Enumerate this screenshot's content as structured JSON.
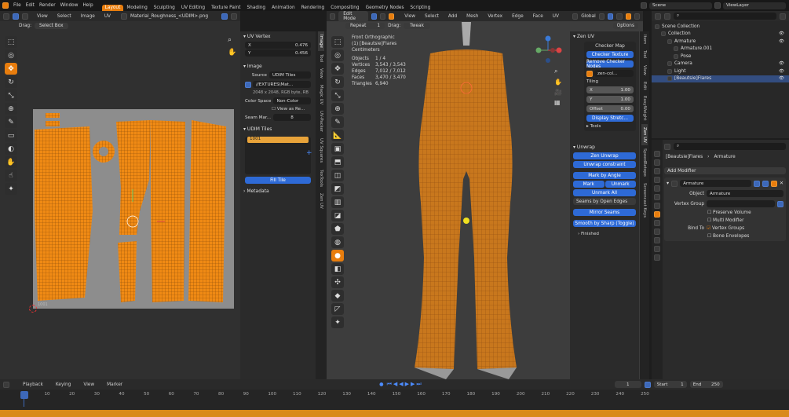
{
  "topbar": {
    "menus": [
      "File",
      "Edit",
      "Render",
      "Window",
      "Help"
    ],
    "workspaces": [
      "Layout",
      "Modeling",
      "Sculpting",
      "UV Editing",
      "Texture Paint",
      "Shading",
      "Animation",
      "Rendering",
      "Compositing",
      "Geometry Nodes",
      "Scripting"
    ],
    "active_workspace": "Layout",
    "scene": "Scene",
    "view_layer": "ViewLayer"
  },
  "uv_editor": {
    "menus": [
      "View",
      "Select",
      "Image",
      "UV"
    ],
    "image_name": "Material_Roughness_<UDIM>.png",
    "drag_label": "Drag:",
    "drag_value": "Select Box",
    "origin_label": "1001"
  },
  "uv_sidebar": {
    "tabs": [
      "Image",
      "Tool",
      "View",
      "Magic UV",
      "UV-Packer",
      "UV Squares",
      "TexTools",
      "Zen UV"
    ],
    "uv_vertex": {
      "title": "UV Vertex",
      "x_label": "X",
      "x_value": "0.476",
      "y_label": "Y",
      "y_value": "0.456"
    },
    "image": {
      "title": "Image",
      "source_label": "Source",
      "source_value": "UDIM Tiles",
      "path": "//EXTURES\\Mat...",
      "info": "2048 x 2048, RGB byte, RB",
      "colorspace_label": "Color Space",
      "colorspace_value": "Non-Color",
      "view_as_render": "View as Re...",
      "seam_label": "Seam Mar...",
      "seam_value": "8"
    },
    "udim": {
      "title": "UDIM Tiles",
      "tile": "1001",
      "fill_tile": "Fill Tile"
    },
    "metadata": "Metadata"
  },
  "viewport": {
    "mode": "Edit Mode",
    "menus": [
      "View",
      "Select",
      "Add",
      "Mesh",
      "Vertex",
      "Edge",
      "Face",
      "UV"
    ],
    "transform": "Global",
    "options": "Options",
    "repeat": "Repeat",
    "repeat_value": "1",
    "drag_label": "Drag:",
    "drag_value": "Tweak",
    "stats": {
      "view": "Front Orthographic",
      "object": "(1) [Beautsie]Flares",
      "units": "Centimeters",
      "rows": [
        [
          "Objects",
          "1 / 4"
        ],
        [
          "Vertices",
          "3,543 / 3,543"
        ],
        [
          "Edges",
          "7,012 / 7,012"
        ],
        [
          "Faces",
          "3,470 / 3,470"
        ],
        [
          "Triangles",
          "6,940"
        ]
      ]
    }
  },
  "zen_uv": {
    "title": "Zen UV",
    "tabs": [
      "Item",
      "Tool",
      "View",
      "Edit",
      "EasyWeight",
      "Zen UV",
      "SpeedRetopo",
      "Screencast Keys"
    ],
    "checker_map": "Checker Map",
    "checker_texture": "Checker Texture",
    "remove_checker": "Remove Checker Nodes",
    "checker_image": "zen-col...",
    "tiling": "Tiling",
    "tx_label": "X",
    "tx": "1.00",
    "ty_label": "Y",
    "ty": "1.00",
    "offset_label": "Offset",
    "offset": "0.00",
    "display_stretch": "Display Stretc...",
    "tools": "Tools",
    "unwrap_title": "Unwrap",
    "zen_unwrap": "Zen Unwrap",
    "unwrap_constraint": "Unwrap constraint",
    "mark_by_angle": "Mark by Angle",
    "mark": "Mark",
    "unmark": "Unmark",
    "unmark_all": "Unmark All",
    "seams_open_edges": "Seams by Open Edges",
    "mirror_seams": "Mirror Seams",
    "smooth_sharp": "Smooth by Sharp (Toggle)",
    "finished": "Finished"
  },
  "outliner": {
    "items": [
      {
        "label": "Scene Collection",
        "indent": 0
      },
      {
        "label": "Collection",
        "indent": 1
      },
      {
        "label": "Armature",
        "indent": 2
      },
      {
        "label": "Armature.001",
        "indent": 3
      },
      {
        "label": "Pose",
        "indent": 3
      },
      {
        "label": "Camera",
        "indent": 2
      },
      {
        "label": "Light",
        "indent": 2
      },
      {
        "label": "[Beautsie]Flares",
        "indent": 2,
        "selected": true
      }
    ]
  },
  "properties": {
    "breadcrumb_obj": "[Beautsie]Flares",
    "breadcrumb_mod": "Armature",
    "add_modifier": "Add Modifier",
    "modifier_name": "Armature",
    "object_label": "Object",
    "object_value": "Armature",
    "vgroup_label": "Vertex Group",
    "preserve_volume": "Preserve Volume",
    "multi_modifier": "Multi Modifier",
    "bind_to": "Bind To",
    "vertex_groups": "Vertex Groups",
    "bone_envelopes": "Bone Envelopes"
  },
  "timeline": {
    "menus": [
      "Playback",
      "Keying",
      "View",
      "Marker"
    ],
    "frame": "1",
    "start_label": "Start",
    "start": "1",
    "end_label": "End",
    "end": "250",
    "ticks": [
      "1",
      "10",
      "20",
      "30",
      "40",
      "50",
      "60",
      "70",
      "80",
      "90",
      "100",
      "110",
      "120",
      "130",
      "140",
      "150",
      "160",
      "170",
      "180",
      "190",
      "200",
      "210",
      "220",
      "230",
      "240",
      "250"
    ]
  },
  "colors": {
    "accent": "#e87d0d",
    "select_blue": "#2e6ad6",
    "uv_bg": "#8c8c8c",
    "mesh_orange": "#d07a1e"
  }
}
